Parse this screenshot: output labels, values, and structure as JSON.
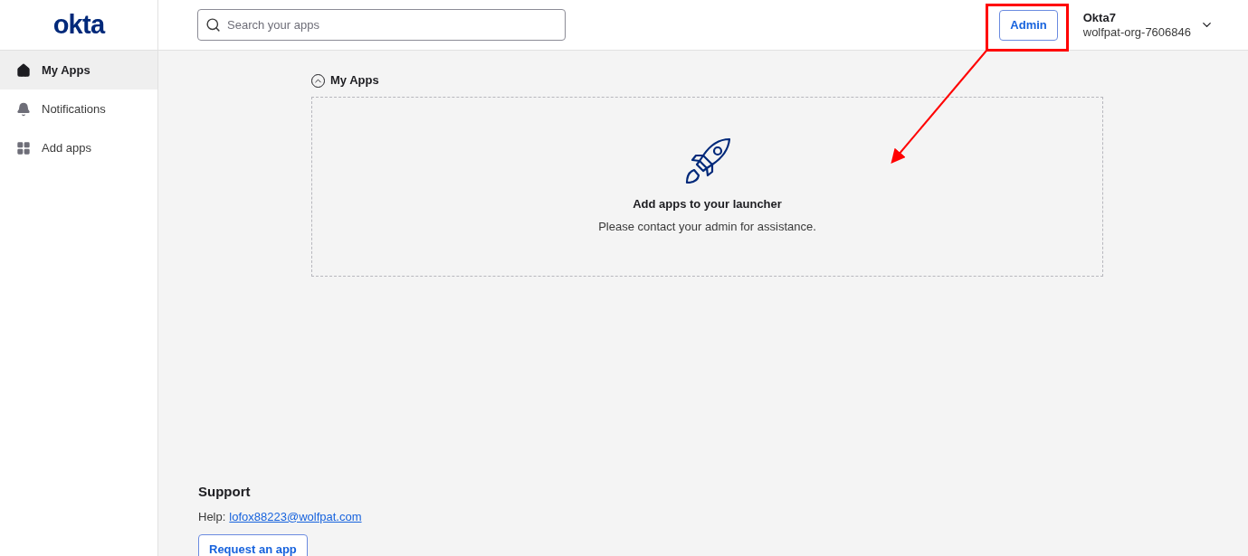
{
  "logo": "okta",
  "search": {
    "placeholder": "Search your apps"
  },
  "header": {
    "admin_button": "Admin",
    "user_name": "Okta7",
    "org": "wolfpat-org-7606846"
  },
  "sidebar": {
    "items": [
      {
        "kind": "home",
        "label": "My Apps",
        "selected": true
      },
      {
        "kind": "bell",
        "label": "Notifications",
        "selected": false
      },
      {
        "kind": "grid",
        "label": "Add apps",
        "selected": false
      }
    ]
  },
  "section": {
    "title": "My Apps",
    "expanded": true,
    "empty_title": "Add apps to your launcher",
    "empty_text": "Please contact your admin for assistance."
  },
  "support": {
    "title": "Support",
    "help_label": "Help:",
    "email": "lofox88223@wolfpat.com",
    "button": "Request an app"
  }
}
